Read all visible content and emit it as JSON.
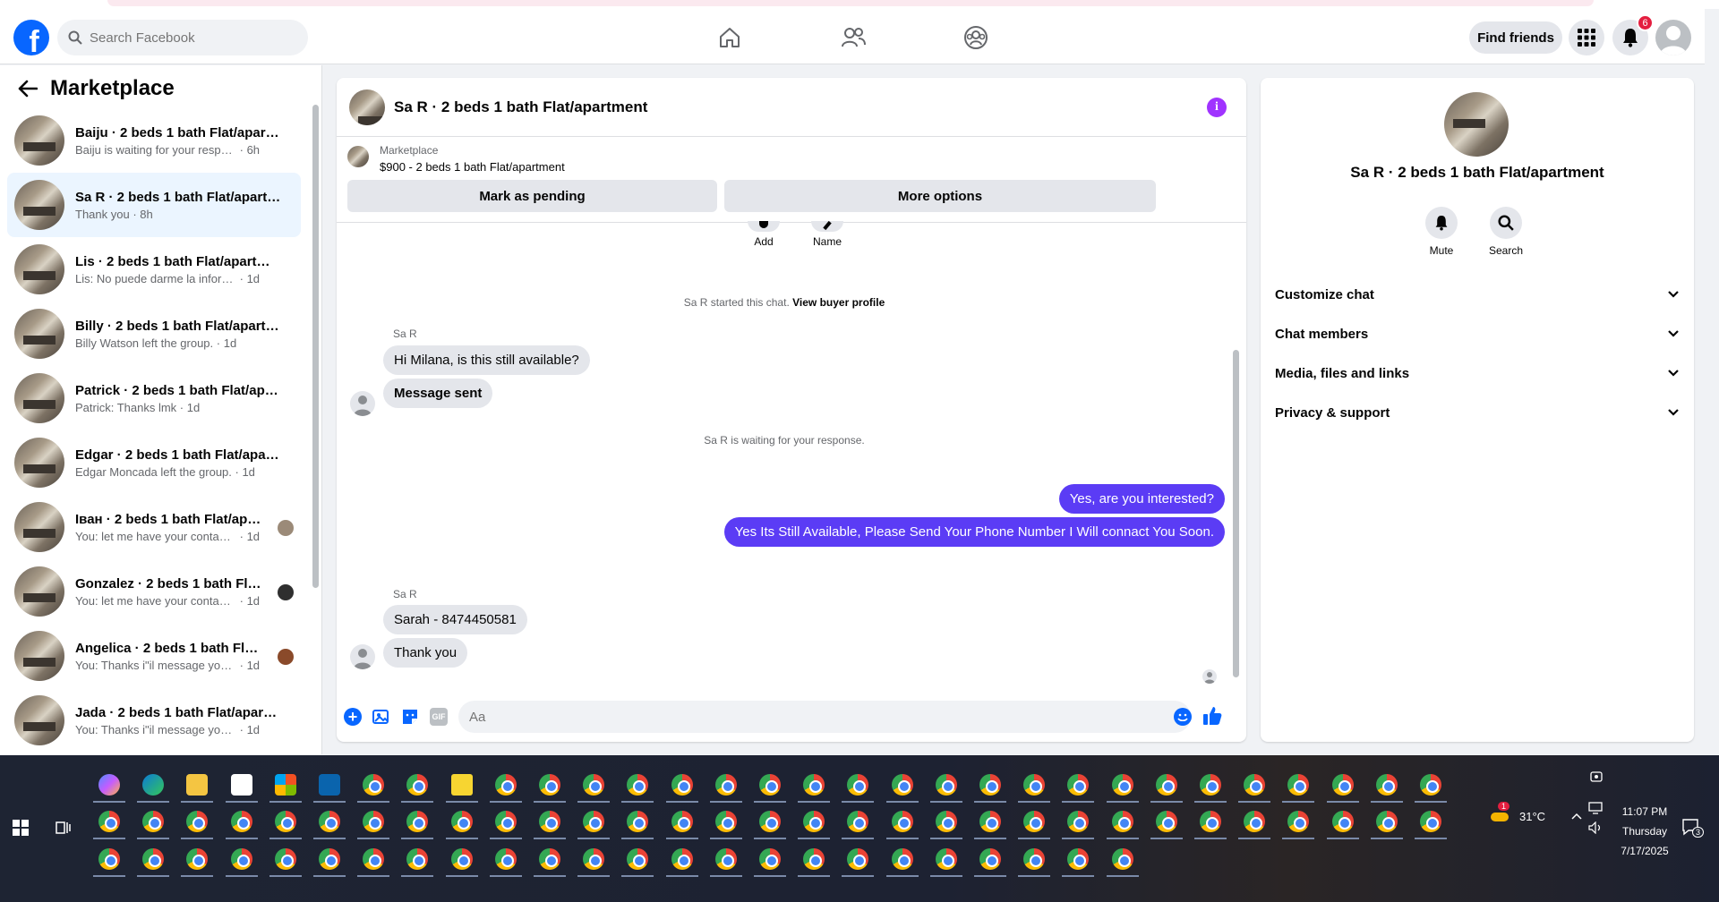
{
  "header": {
    "search_placeholder": "Search Facebook",
    "find_friends_label": "Find friends",
    "notification_count": "6"
  },
  "sidebar": {
    "title": "Marketplace",
    "conversations": [
      {
        "title": "Baiju · 2 beds 1 bath Flat/apartm...",
        "message": "Baiju is waiting for your response.......",
        "time": "6h"
      },
      {
        "title": "Sa R · 2 beds 1 bath Flat/apartm...",
        "message": "Thank you",
        "time": "8h"
      },
      {
        "title": "Lis · 2 beds 1 bath Flat/apartment",
        "message": "Lis: No puede darme la informació...",
        "time": "1d"
      },
      {
        "title": "Billy · 2 beds 1 bath Flat/apartm...",
        "message": "Billy Watson left the group.",
        "time": "1d"
      },
      {
        "title": "Patrick · 2 beds 1 bath Flat/apart...",
        "message": "Patrick: Thanks lmk",
        "time": "1d"
      },
      {
        "title": "Edgar · 2 beds 1 bath Flat/apart...",
        "message": "Edgar Moncada left the group.",
        "time": "1d"
      },
      {
        "title": "Іван · 2 beds 1 bath Flat/apart...",
        "message": "You: let me have your contact n...",
        "time": "1d"
      },
      {
        "title": "Gonzalez · 2 beds 1 bath Flat/...",
        "message": "You: let me have your contact n...",
        "time": "1d"
      },
      {
        "title": "Angelica · 2 beds 1 bath Flat/a...",
        "message": "You: Thanks i\"il message you in ...",
        "time": "1d"
      },
      {
        "title": "Jada · 2 beds 1 bath Flat/apartm...",
        "message": "You: Thanks i\"il message you in a ...",
        "time": "1d"
      }
    ]
  },
  "chat": {
    "title": "Sa R · 2 beds 1 bath Flat/apartment",
    "marketplace_label": "Marketplace",
    "listing": "$900 - 2 beds 1 bath Flat/apartment",
    "mark_pending_label": "Mark as pending",
    "more_options_label": "More options",
    "add_label": "Add",
    "name_label": "Name",
    "started_text": "Sa R started this chat.",
    "view_buyer_label": "View buyer profile",
    "waiting_text": "Sa R is waiting for your response.",
    "sender_name": "Sa R",
    "messages": {
      "m1": "Hi Milana, is this still available?",
      "m2": "Message sent",
      "m3": "Yes, are you interested?",
      "m4": "Yes Its Still Available, Please Send Your Phone Number I Will connact You Soon.",
      "m5": "Sarah - 8474450581",
      "m6": "Thank you"
    },
    "composer_placeholder": "Aa",
    "gif_label": "GIF"
  },
  "info_panel": {
    "title": "Sa R · 2 beds 1 bath Flat/apartment",
    "mute_label": "Mute",
    "search_label": "Search",
    "sections": [
      "Customize chat",
      "Chat members",
      "Media, files and links",
      "Privacy & support"
    ]
  },
  "taskbar": {
    "temperature": "31°C",
    "weather_badge": "1",
    "time": "11:07 PM",
    "day": "Thursday",
    "date": "7/17/2025",
    "notification_badge": "3"
  },
  "colors": {
    "fb_blue": "#0866ff",
    "outgoing_bubble": "#5b3cf5",
    "active_conversation": "#ebf5ff",
    "info_icon": "#a033ff",
    "badge_red": "#e41e3f"
  }
}
